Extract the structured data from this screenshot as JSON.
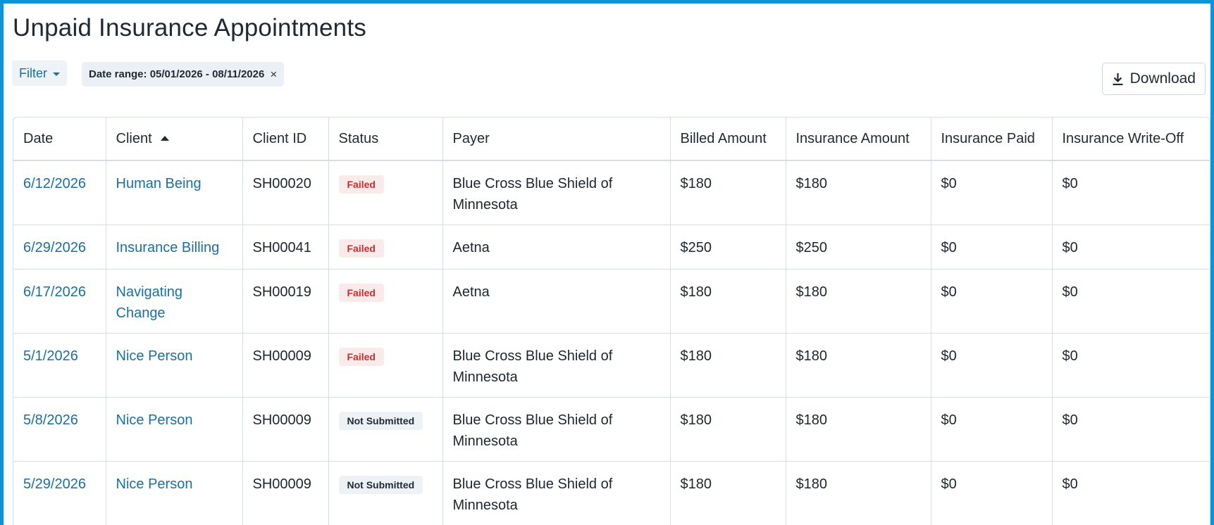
{
  "page": {
    "title": "Unpaid Insurance Appointments"
  },
  "toolbar": {
    "filter_label": "Filter",
    "chip_label": "Date range: 05/01/2026 - 08/11/2026",
    "chip_close": "×",
    "download_label": "Download"
  },
  "colors": {
    "accent": "#0e93d9",
    "link": "#1a6fa0",
    "failed": "#c62d2d"
  },
  "icons": {
    "download": "download-icon",
    "filter_caret": "chevron-down-icon",
    "sort": "sort-ascending-icon"
  },
  "table": {
    "columns": [
      "Date",
      "Client",
      "Client ID",
      "Status",
      "Payer",
      "Billed Amount",
      "Insurance Amount",
      "Insurance Paid",
      "Insurance Write-Off"
    ],
    "sort_column": "Client",
    "rows": [
      {
        "date": "6/12/2026",
        "client": "Human Being",
        "client_id": "SH00020",
        "status": "Failed",
        "payer": "Blue Cross Blue Shield of Minnesota",
        "billed": "$180",
        "ins_amount": "$180",
        "ins_paid": "$0",
        "write_off": "$0"
      },
      {
        "date": "6/29/2026",
        "client": "Insurance Billing",
        "client_id": "SH00041",
        "status": "Failed",
        "payer": "Aetna",
        "billed": "$250",
        "ins_amount": "$250",
        "ins_paid": "$0",
        "write_off": "$0"
      },
      {
        "date": "6/17/2026",
        "client": "Navigating Change",
        "client_id": "SH00019",
        "status": "Failed",
        "payer": "Aetna",
        "billed": "$180",
        "ins_amount": "$180",
        "ins_paid": "$0",
        "write_off": "$0"
      },
      {
        "date": "5/1/2026",
        "client": "Nice Person",
        "client_id": "SH00009",
        "status": "Failed",
        "payer": "Blue Cross Blue Shield of Minnesota",
        "billed": "$180",
        "ins_amount": "$180",
        "ins_paid": "$0",
        "write_off": "$0"
      },
      {
        "date": "5/8/2026",
        "client": "Nice Person",
        "client_id": "SH00009",
        "status": "Not Submitted",
        "payer": "Blue Cross Blue Shield of Minnesota",
        "billed": "$180",
        "ins_amount": "$180",
        "ins_paid": "$0",
        "write_off": "$0"
      },
      {
        "date": "5/29/2026",
        "client": "Nice Person",
        "client_id": "SH00009",
        "status": "Not Submitted",
        "payer": "Blue Cross Blue Shield of Minnesota",
        "billed": "$180",
        "ins_amount": "$180",
        "ins_paid": "$0",
        "write_off": "$0"
      }
    ]
  }
}
